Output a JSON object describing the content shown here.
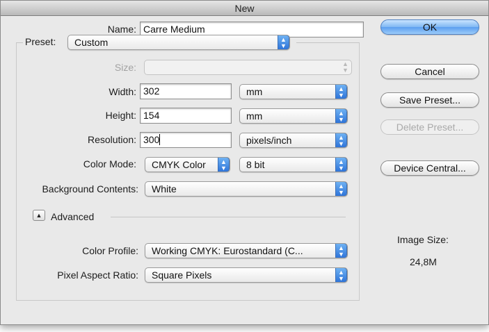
{
  "window": {
    "title": "New"
  },
  "form": {
    "name": {
      "label": "Name:",
      "value": "Carre Medium"
    },
    "preset": {
      "label": "Preset:",
      "value": "Custom"
    },
    "size": {
      "label": "Size:",
      "value": ""
    },
    "width": {
      "label": "Width:",
      "value": "302",
      "unit": "mm"
    },
    "height": {
      "label": "Height:",
      "value": "154",
      "unit": "mm"
    },
    "resolution": {
      "label": "Resolution:",
      "value": "300",
      "unit": "pixels/inch"
    },
    "color_mode": {
      "label": "Color Mode:",
      "value": "CMYK Color",
      "depth": "8 bit"
    },
    "background_contents": {
      "label": "Background Contents:",
      "value": "White"
    },
    "advanced": {
      "label": "Advanced",
      "expanded": true
    },
    "color_profile": {
      "label": "Color Profile:",
      "value": "Working CMYK:  Eurostandard (C..."
    },
    "pixel_aspect_ratio": {
      "label": "Pixel Aspect Ratio:",
      "value": "Square Pixels"
    }
  },
  "buttons": {
    "ok": "OK",
    "cancel": "Cancel",
    "save_preset": "Save Preset...",
    "delete_preset": "Delete Preset...",
    "device_central": "Device Central..."
  },
  "image_size": {
    "label": "Image Size:",
    "value": "24,8M"
  },
  "icons": {
    "popup_arrows": "up-down-arrows-icon",
    "disclosure": "triangle-up-icon"
  },
  "colors": {
    "default_button": "#5c9ff0",
    "popup_arrows": "#2e74d9"
  }
}
